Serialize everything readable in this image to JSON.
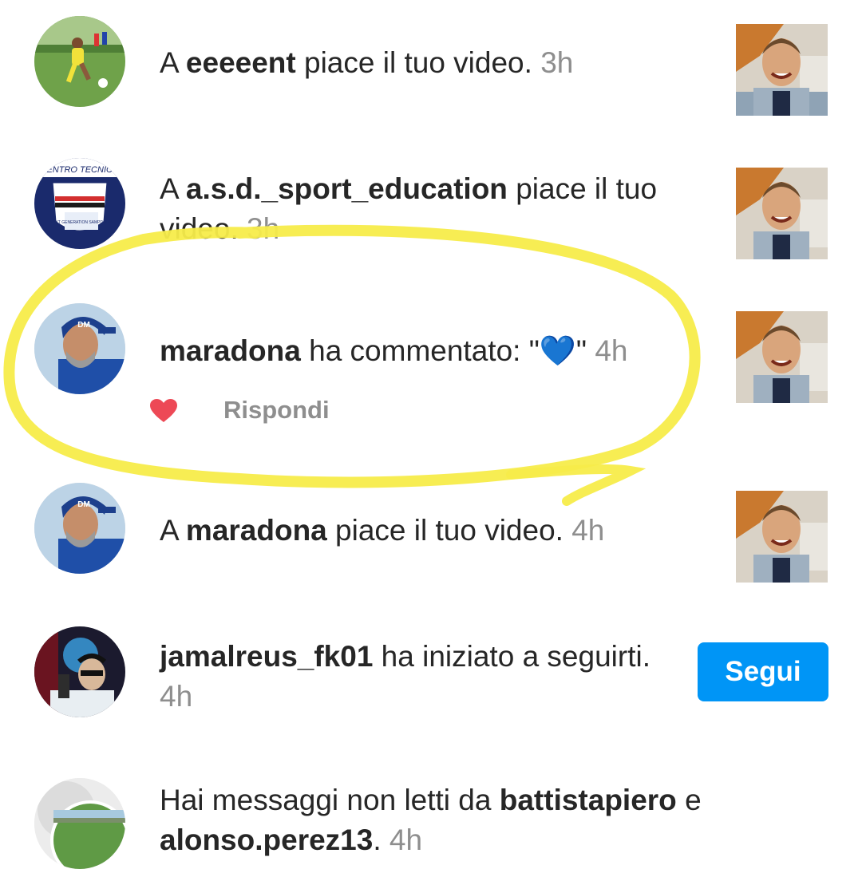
{
  "notifications": [
    {
      "prefix": "A ",
      "user": "eeeeent",
      "suffix": " piace il tuo video.",
      "time": " 3h",
      "avatar_icon": "soccer-player-avatar",
      "thumbnail": "boy-video-thumbnail"
    },
    {
      "prefix": "A ",
      "user": "a.s.d._sport_education",
      "suffix": " piace il tuo video.",
      "time": " 3h",
      "avatar_icon": "centro-tecnico-logo-avatar",
      "avatar_text_top": "CENTRO TECNICO",
      "avatar_text_badge": "NEXT GENERATION SAMPDORIA",
      "thumbnail": "boy-video-thumbnail"
    },
    {
      "user": "maradona",
      "suffix": " ha commentato: \"",
      "emoji": "💙",
      "close_quote": "\"",
      "time": " 4h",
      "reply_label": "Rispondi",
      "avatar_icon": "maradona-avatar",
      "cap_text": "DM",
      "thumbnail": "boy-video-thumbnail"
    },
    {
      "prefix": "A ",
      "user": "maradona",
      "suffix": " piace il tuo video.",
      "time": " 4h",
      "avatar_icon": "maradona-avatar",
      "cap_text": "DM",
      "thumbnail": "boy-video-thumbnail"
    },
    {
      "user": "jamalreus_fk01",
      "suffix": " ha iniziato a seguirti.",
      "time": " 4h",
      "follow_label": "Segui",
      "avatar_icon": "dj-avatar"
    },
    {
      "prefix": "Hai messaggi non letti da ",
      "user": "battistapiero",
      "middle": " e ",
      "user2": "alonso.perez13",
      "suffix": ".",
      "time": " 4h",
      "avatar_icon": "group-avatar"
    }
  ],
  "colors": {
    "accent": "#0095f6",
    "highlight_marker": "#f7ec4a",
    "like_heart": "#ed4956",
    "secondary_text": "#8e8e8e"
  }
}
